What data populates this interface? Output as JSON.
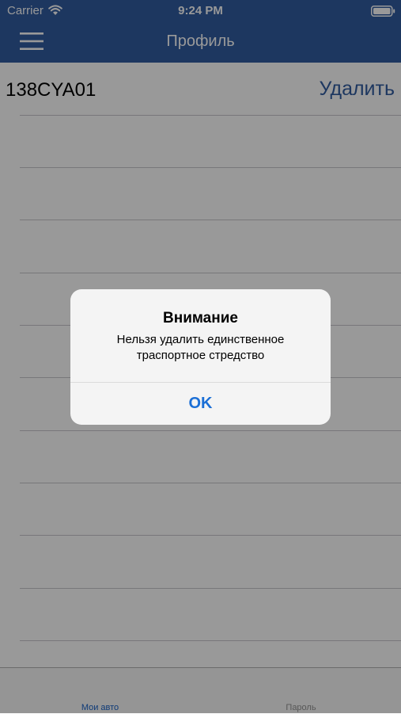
{
  "status_bar": {
    "carrier": "Carrier",
    "time": "9:24 PM",
    "wifi_icon": "wifi-icon",
    "battery_icon": "battery-icon"
  },
  "nav_bar": {
    "title": "Профиль",
    "menu_icon": "hamburger-menu-icon",
    "background_color": "#315ca0"
  },
  "car_list": {
    "items": [
      {
        "plate": "138CYA01",
        "delete_label": "Удалить"
      }
    ]
  },
  "tab_bar": {
    "tabs": [
      {
        "label": "Мои авто",
        "active": true
      },
      {
        "label": "Пароль",
        "active": false
      }
    ],
    "active_color": "#1a63c8",
    "inactive_color": "#929292"
  },
  "alert": {
    "title": "Внимание",
    "message_line1": "Нельзя удалить единственное",
    "message_line2": "траспортное стредство",
    "ok_label": "OK",
    "button_color": "#1b6fd6"
  }
}
